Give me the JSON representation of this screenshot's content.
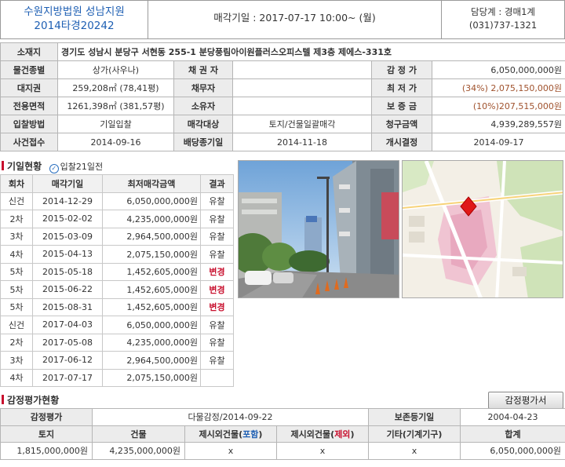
{
  "header": {
    "court_line1": "수원지방법원 성남지원",
    "court_line2": "2014타경20242",
    "auction_date": "매각기일 : 2017-07-17   10:00~ (월)",
    "dept": "담당계 : 경매1계",
    "phone": "(031)737-1321"
  },
  "info": {
    "address_label": "소재지",
    "address": "경기도 성남시 분당구 서현동 255-1 분당풍림아이원플러스오피스텔 제3층 제에스-331호",
    "row1": {
      "l1": "물건종별",
      "v1": "상가(사우나)",
      "l2": "채 권 자",
      "v2": "",
      "l3": "감 정 가",
      "v3": "6,050,000,000원"
    },
    "row2": {
      "l1": "대지권",
      "v1": "259,208㎡ (78,41평)",
      "l2": "채무자",
      "v2": "",
      "l3": "최 저 가",
      "v3": "(34%) 2,075,150,000원"
    },
    "row3": {
      "l1": "전용면적",
      "v1": "1261,398㎡ (381,57평)",
      "l2": "소유자",
      "v2": "",
      "l3": "보 증 금",
      "v3": "(10%)207,515,000원"
    },
    "row4": {
      "l1": "입찰방법",
      "v1": "기일입찰",
      "l2": "매각대상",
      "v2": "토지/건물일괄매각",
      "l3": "청구금액",
      "v3": "4,939,289,557원"
    },
    "row5": {
      "l1": "사건접수",
      "v1": "2014-09-16",
      "l2": "배당종기일",
      "v2": "2014-11-18",
      "l3": "개시결정",
      "v3": "2014-09-17"
    }
  },
  "history": {
    "title": "기일현황",
    "badge": "입찰21일전",
    "headers": [
      "회차",
      "매각기일",
      "최저매각금액",
      "결과"
    ],
    "rows": [
      {
        "round": "신건",
        "date": "2014-12-29",
        "price": "6,050,000,000원",
        "result": "유찰",
        "red": false
      },
      {
        "round": "2차",
        "date": "2015-02-02",
        "price": "4,235,000,000원",
        "result": "유찰",
        "red": false
      },
      {
        "round": "3차",
        "date": "2015-03-09",
        "price": "2,964,500,000원",
        "result": "유찰",
        "red": false
      },
      {
        "round": "4차",
        "date": "2015-04-13",
        "price": "2,075,150,000원",
        "result": "유찰",
        "red": false
      },
      {
        "round": "5차",
        "date": "2015-05-18",
        "price": "1,452,605,000원",
        "result": "변경",
        "red": true
      },
      {
        "round": "5차",
        "date": "2015-06-22",
        "price": "1,452,605,000원",
        "result": "변경",
        "red": true
      },
      {
        "round": "5차",
        "date": "2015-08-31",
        "price": "1,452,605,000원",
        "result": "변경",
        "red": true
      },
      {
        "round": "신건",
        "date": "2017-04-03",
        "price": "6,050,000,000원",
        "result": "유찰",
        "red": false
      },
      {
        "round": "2차",
        "date": "2017-05-08",
        "price": "4,235,000,000원",
        "result": "유찰",
        "red": false
      },
      {
        "round": "3차",
        "date": "2017-06-12",
        "price": "2,964,500,000원",
        "result": "유찰",
        "red": false
      },
      {
        "round": "4차",
        "date": "2017-07-17",
        "price": "2,075,150,000원",
        "result": "",
        "red": false
      }
    ]
  },
  "appraisal": {
    "title": "감정평가현황",
    "button": "감정평가서",
    "r1": {
      "l1": "감정평가",
      "v1": "다물감정/2014-09-22",
      "l2": "보존등기일",
      "v2": "2004-04-23"
    },
    "headers": {
      "land": "토지",
      "building": "건물",
      "incl_pre": "제시외건물(",
      "incl_mid": "포함",
      "excl_pre": "제시외건물(",
      "excl_mid": "제외",
      "close": ")",
      "machine": "기타(기계기구)",
      "total": "합계"
    },
    "values": {
      "land": "1,815,000,000원",
      "building": "4,235,000,000원",
      "incl": "x",
      "excl": "x",
      "machine": "x",
      "total": "6,050,000,000원"
    }
  },
  "colors": {
    "accent_blue": "#1e5fb3",
    "accent_red": "#c8102e",
    "label_bg": "#ececec"
  },
  "icons": {
    "check": "check-circle-icon",
    "section": "red-bar-icon",
    "photo": "building-photo",
    "map": "location-map"
  }
}
